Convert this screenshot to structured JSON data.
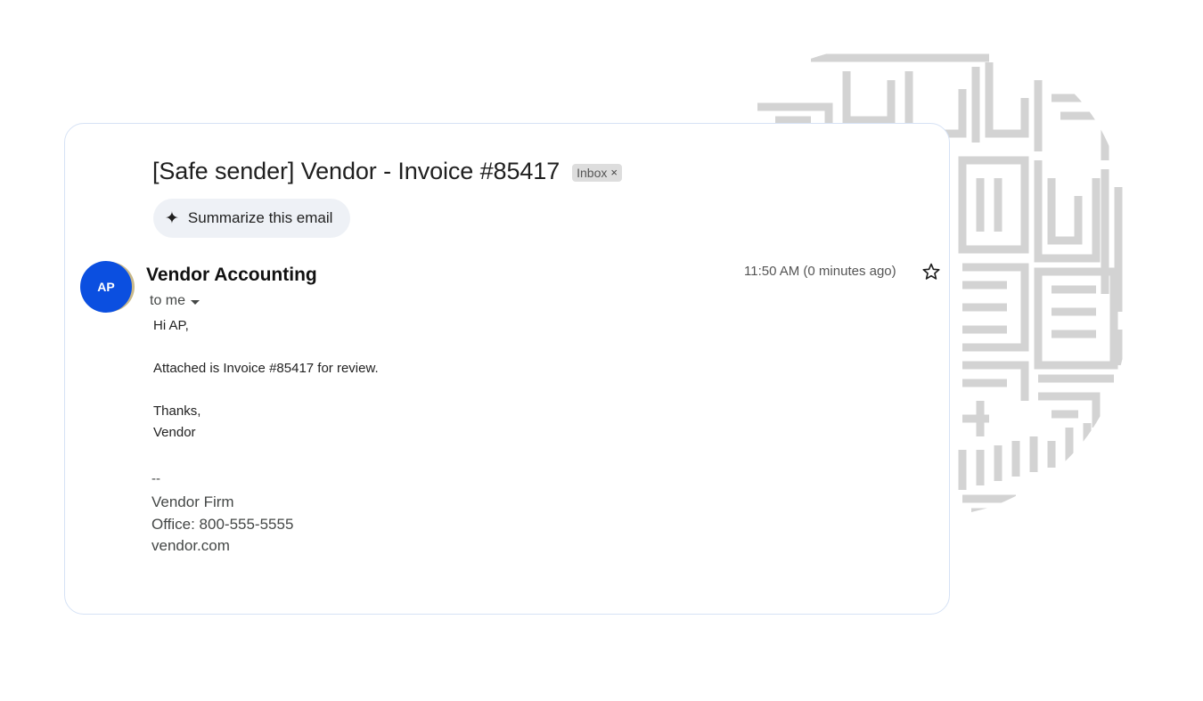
{
  "email": {
    "subject": "[Safe sender] Vendor - Invoice #85417",
    "label_chip": "Inbox",
    "label_remove": "×",
    "summarize_label": "Summarize this email",
    "sender_initials": "AP",
    "sender_name": "Vendor Accounting",
    "recipient": "to me",
    "timestamp": "11:50 AM (0 minutes ago)",
    "body": {
      "greeting": "Hi AP,",
      "line1": "Attached is Invoice #85417 for review.",
      "closing": "Thanks,",
      "closing_name": "Vendor"
    },
    "signature": {
      "separator": "--",
      "company": "Vendor Firm",
      "office": "Office: 800-555-5555",
      "website": "vendor.com"
    }
  },
  "colors": {
    "avatar": "#0b4fe0",
    "card_border": "#d6e2f5",
    "summarize_bg": "#eef1f6",
    "maze_pattern": "#d3d3d3"
  },
  "icons": {
    "sparkle": "sparkle-icon",
    "star": "star-icon",
    "caret": "chevron-down-icon",
    "chip_close": "close-icon"
  }
}
